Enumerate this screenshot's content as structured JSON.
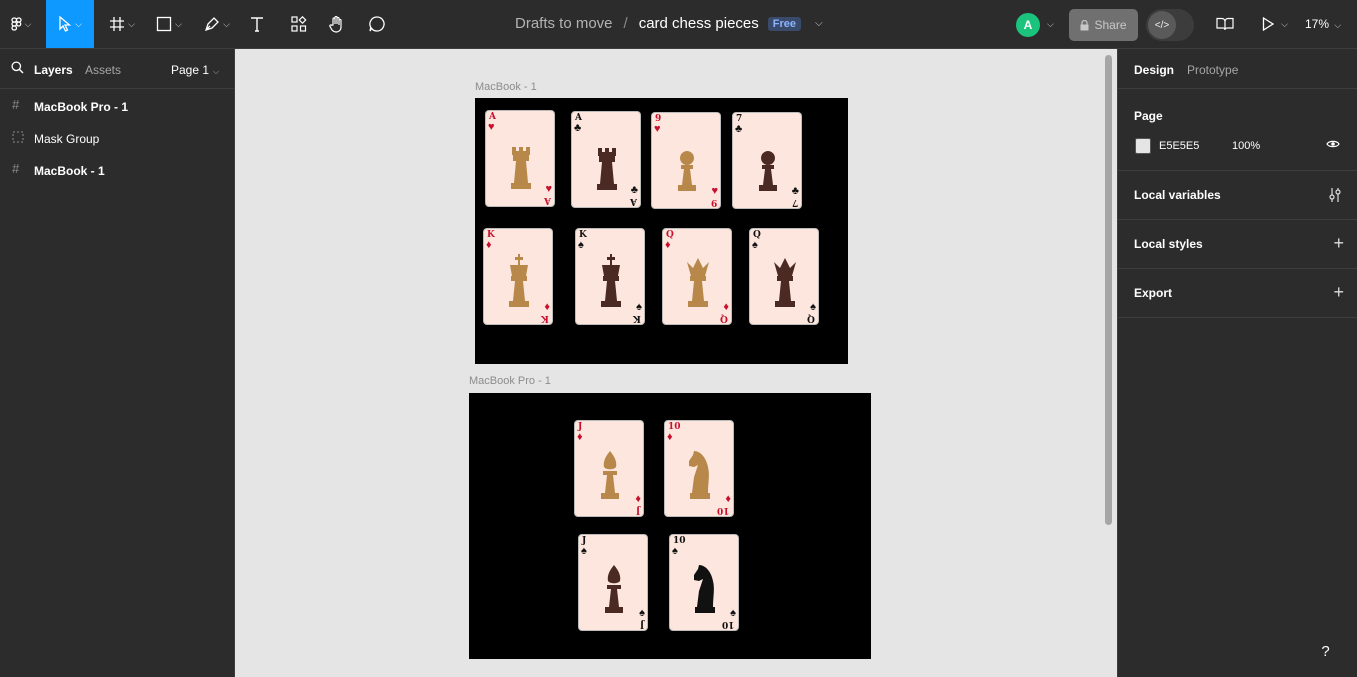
{
  "toolbar": {
    "tools": [
      "main-menu",
      "move",
      "frame",
      "shape",
      "pen",
      "text",
      "resources",
      "hand",
      "comment"
    ],
    "project": "Drafts to move",
    "separator": "/",
    "file_name": "card chess pieces",
    "plan_badge": "Free",
    "avatar_initial": "A",
    "share_label": "Share",
    "zoom": "17%",
    "accent": "#0d99ff"
  },
  "left_panel": {
    "tab_layers": "Layers",
    "tab_assets": "Assets",
    "page_selector": "Page 1",
    "layers": [
      {
        "name": "MacBook Pro - 1",
        "icon": "frame-icon",
        "bold": true
      },
      {
        "name": "Mask Group",
        "icon": "mask-group-icon",
        "bold": false
      },
      {
        "name": "MacBook - 1",
        "icon": "frame-icon",
        "bold": true
      }
    ]
  },
  "right_panel": {
    "tab_design": "Design",
    "tab_prototype": "Prototype",
    "page_heading": "Page",
    "page_color": "E5E5E5",
    "page_opacity": "100%",
    "local_variables": "Local variables",
    "local_styles": "Local styles",
    "export": "Export"
  },
  "canvas": {
    "background": "#e5e5e5",
    "frame1_label": "MacBook - 1",
    "frame2_label": "MacBook Pro - 1",
    "frame1_cards": [
      {
        "rank": "A",
        "suit": "♥",
        "color": "#c8102e",
        "piece": "rook",
        "tone": "#b8874a"
      },
      {
        "rank": "A",
        "suit": "♣",
        "color": "#111111",
        "piece": "rook",
        "tone": "#4a2a22"
      },
      {
        "rank": "9",
        "suit": "♥",
        "color": "#c8102e",
        "piece": "pawn",
        "tone": "#b8874a"
      },
      {
        "rank": "7",
        "suit": "♣",
        "color": "#111111",
        "piece": "pawn",
        "tone": "#4a2a22"
      },
      {
        "rank": "K",
        "suit": "♦",
        "color": "#c8102e",
        "piece": "king",
        "tone": "#b8874a"
      },
      {
        "rank": "K",
        "suit": "♠",
        "color": "#111111",
        "piece": "king",
        "tone": "#4a2a22"
      },
      {
        "rank": "Q",
        "suit": "♦",
        "color": "#c8102e",
        "piece": "queen",
        "tone": "#b8874a"
      },
      {
        "rank": "Q",
        "suit": "♠",
        "color": "#111111",
        "piece": "queen",
        "tone": "#4a2a22"
      }
    ],
    "frame2_cards": [
      {
        "rank": "J",
        "suit": "♦",
        "color": "#c8102e",
        "piece": "bishop",
        "tone": "#b8874a"
      },
      {
        "rank": "10",
        "suit": "♦",
        "color": "#c8102e",
        "piece": "knight",
        "tone": "#b8874a"
      },
      {
        "rank": "J",
        "suit": "♠",
        "color": "#111111",
        "piece": "bishop",
        "tone": "#4a2a22"
      },
      {
        "rank": "10",
        "suit": "♠",
        "color": "#111111",
        "piece": "knight",
        "tone": "#111111"
      }
    ]
  }
}
